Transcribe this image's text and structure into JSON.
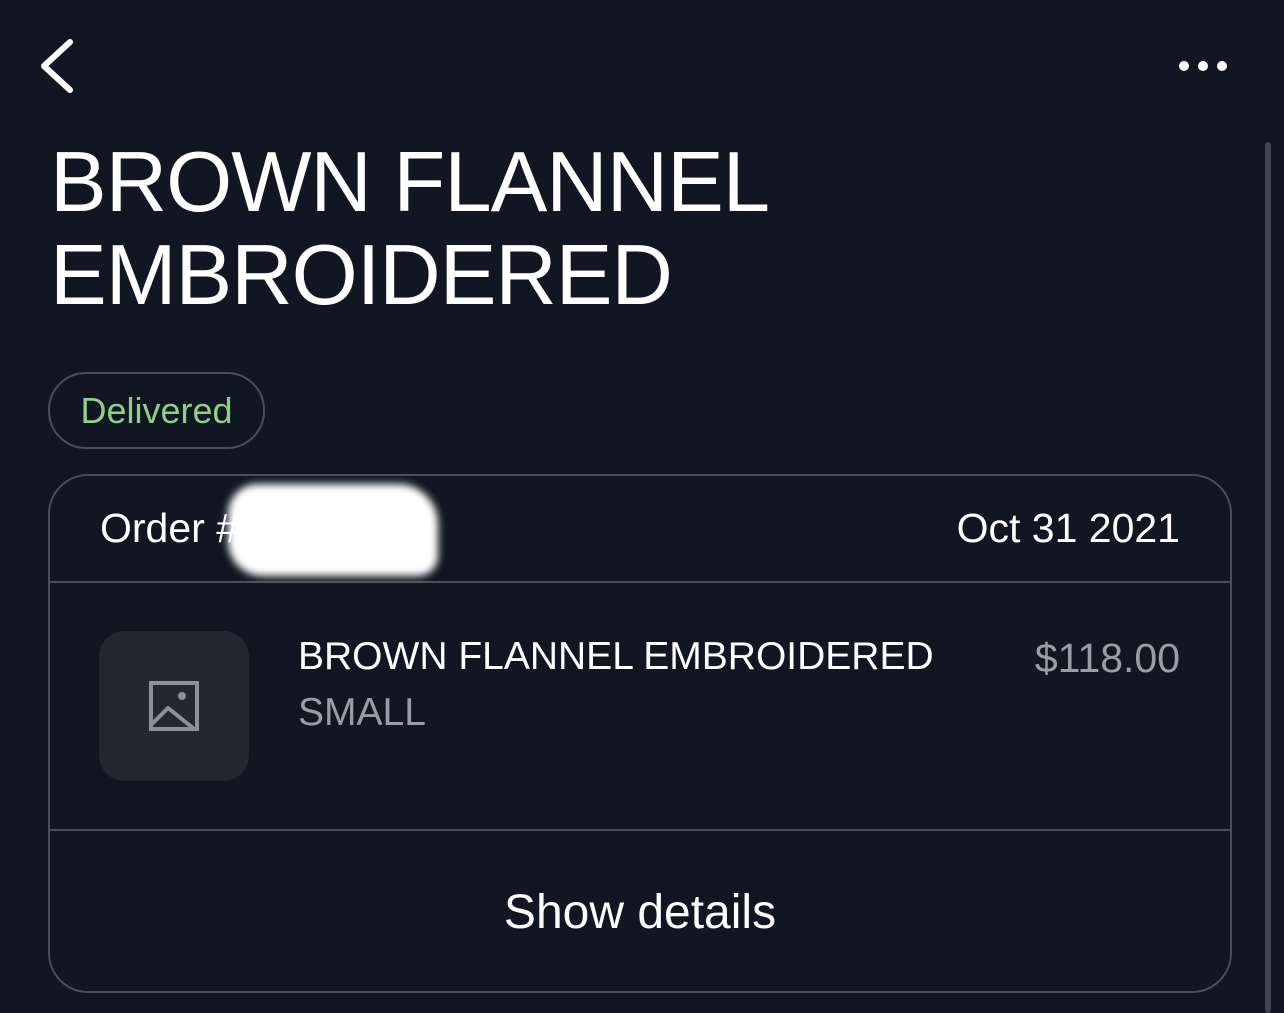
{
  "header": {
    "back_icon": "chevron-left-icon",
    "more_icon": "more-horizontal-icon"
  },
  "page": {
    "title": "BROWN FLANNEL\nEMBROIDERED",
    "status": "Delivered",
    "status_color": "#8fcf8a"
  },
  "order": {
    "number_label": "Order #",
    "date": "Oct 31 2021",
    "item": {
      "name": "BROWN FLANNEL EMBROIDERED",
      "size": "SMALL",
      "price": "$118.00",
      "image_icon": "image-placeholder-icon"
    },
    "details_label": "Show details"
  },
  "colors": {
    "background": "#111722",
    "border": "#4a4e56",
    "muted_text": "#9a9da3"
  }
}
